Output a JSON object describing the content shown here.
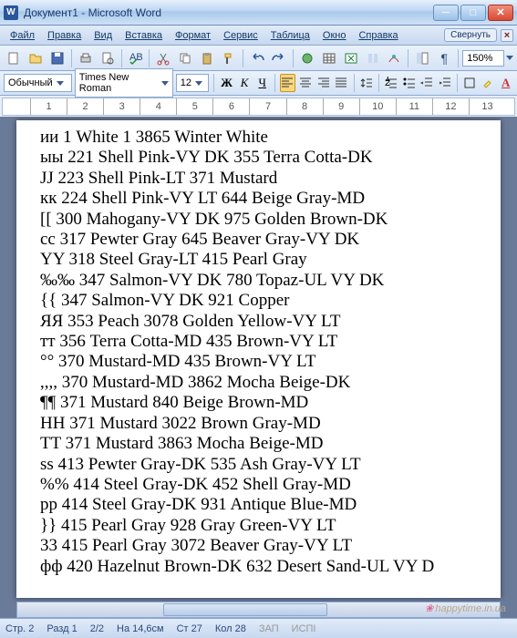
{
  "title": "Документ1 - Microsoft Word",
  "menus": [
    "Файл",
    "Правка",
    "Вид",
    "Вставка",
    "Формат",
    "Сервис",
    "Таблица",
    "Окно",
    "Справка"
  ],
  "collapse": "Свернуть",
  "zoom": "150%",
  "style": "Обычный",
  "font": "Times New Roman",
  "size": "12",
  "ruler": [
    "1",
    "2",
    "3",
    "4",
    "5",
    "6",
    "7",
    "8",
    "9",
    "10",
    "11",
    "12",
    "13"
  ],
  "lines": [
    "ии 1   White 1  3865 Winter White",
    "ыы 221  Shell Pink-VY DK  355 Terra Cotta-DK",
    "JJ 223 Shell Pink-LT  371 Mustard",
    "кк 224  Shell Pink-VY LT  644 Beige Gray-MD",
    "[[ 300  Mahogany-VY DK  975 Golden Brown-DK",
    "cc 317  Pewter Gray  645 Beaver Gray-VY DK",
    "YY 318  Steel Gray-LT  415 Pearl Gray",
    "‰‰ 347  Salmon-VY DK  780 Topaz-UL VY DK",
    "{{ 347 Salmon-VY DK  921 Copper",
    "ЯЯ 353 Peach  3078 Golden Yellow-VY LT",
    "тт 356  Terra Cotta-MD  435 Brown-VY LT",
    "°° 370 Mustard-MD  435 Brown-VY LT",
    ",,,, 370 Mustard-MD  3862 Mocha Beige-DK",
    "¶¶ 371 Mustard  840 Beige Brown-MD",
    "HH 371 Mustard  3022 Brown Gray-MD",
    "TT 371 Mustard  3863 Mocha Beige-MD",
    "ss 413  Pewter Gray-DK  535 Ash Gray-VY LT",
    "%% 414  Steel Gray-DK  452 Shell Gray-MD",
    "pp 414  Steel Gray-DK  931 Antique Blue-MD",
    "}} 415  Pearl Gray  928 Gray Green-VY LT",
    "33 415  Pearl Gray  3072 Beaver Gray-VY LT",
    "фф 420  Hazelnut Brown-DK  632 Desert Sand-UL VY D"
  ],
  "status": {
    "page": "Стр. 2",
    "sect": "Разд 1",
    "pages": "2/2",
    "at": "На 14,6см",
    "line": "Ст 27",
    "col": "Кол 28",
    "rec": "ЗАП",
    "track": "ИСПІ"
  },
  "watermark": "happytime.in.ua"
}
